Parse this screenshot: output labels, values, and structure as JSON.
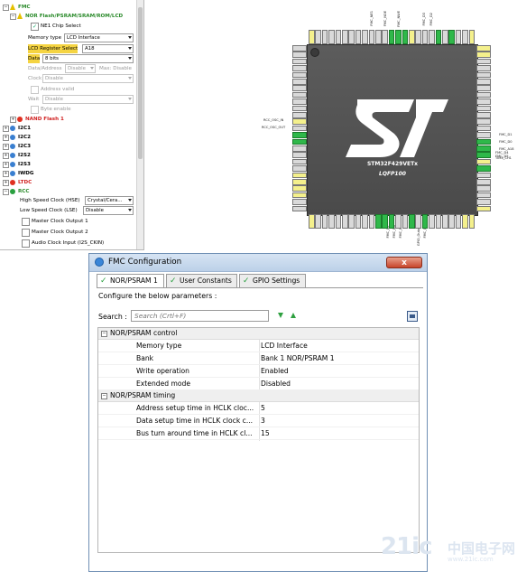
{
  "tree": {
    "fmc": "FMC",
    "nor_flash": "NOR Flash/PSRAM/SRAM/ROM/LCD",
    "ne1_chip_select": "NE1 Chip Select",
    "memory_type_label": "Memory type",
    "memory_type_value": "LCD Interface",
    "lcd_register_select_label": "LCD Register Select",
    "lcd_register_select_value": "A18",
    "data_label": "Data",
    "data_value": "8 bits",
    "data_address_label": "Data/Address",
    "data_address_value": "Disable",
    "max_disable_label": "Max: Disable",
    "clock_label": "Clock",
    "clock_value": "Disable",
    "address_valid": "Address valid",
    "wait_label": "Wait",
    "wait_value": "Disable",
    "byte_enable": "Byte enable",
    "nand_flash": "NAND Flash 1",
    "i2c1": "I2C1",
    "i2c2": "I2C2",
    "i2c3": "I2C3",
    "i2s2": "I2S2",
    "i2s3": "I2S3",
    "iwdg": "IWDG",
    "ltdc": "LTDC",
    "rcc": "RCC",
    "hse_label": "High Speed Clock (HSE)",
    "hse_value": "Crystal/Cera...",
    "lse_label": "Low Speed Clock (LSE)",
    "lse_value": "Disable",
    "mco1": "Master Clock Output 1",
    "mco2": "Master Clock Output 2",
    "audio_clock": "Audio Clock Input (I2S_CKIN)"
  },
  "chip": {
    "part_number": "STM32F429VETx",
    "package": "LQFP100",
    "rcc_osc_in": "RCC_OSC_IN",
    "rcc_osc_out": "RCC_OSC_OUT",
    "right_labels": [
      "FMC_D1",
      "FMC_D0",
      "FMC_A18",
      "FMC_D4",
      "FMC_D5",
      "TIM4_CH1"
    ],
    "top_labels": [
      "FMC_NE1",
      "FMC_NOE",
      "FMC_NWE",
      "FMC_D3",
      "FMC_D2"
    ],
    "bottom_labels": [
      "FMC_D7",
      "FMC_D6",
      "FMC_D5",
      "GPIO_Output",
      "FMC_D4"
    ],
    "logo": "ST"
  },
  "dialog": {
    "title": "FMC Configuration",
    "close_label": "x",
    "tabs": [
      {
        "label": "NOR/PSRAM 1"
      },
      {
        "label": "User Constants"
      },
      {
        "label": "GPIO Settings"
      }
    ],
    "configure_text": "Configure the below parameters :",
    "search_label": "Search :",
    "search_placeholder": "Search (Crtl+F)",
    "groups": [
      {
        "title": "NOR/PSRAM control",
        "rows": [
          {
            "key": "Memory type",
            "value": "LCD Interface"
          },
          {
            "key": "Bank",
            "value": "Bank 1 NOR/PSRAM 1"
          },
          {
            "key": "Write operation",
            "value": "Enabled"
          },
          {
            "key": "Extended mode",
            "value": "Disabled"
          }
        ]
      },
      {
        "title": "NOR/PSRAM timing",
        "rows": [
          {
            "key": "Address setup time in HCLK cloc...",
            "value": "5"
          },
          {
            "key": "Data setup time in HCLK clock c...",
            "value": "3"
          },
          {
            "key": "Bus turn around time in HCLK cl...",
            "value": "15"
          }
        ]
      }
    ]
  },
  "watermark": {
    "big": "21ic",
    "cn": "中国电子网",
    "url": "www.21ic.com"
  },
  "colors": {
    "pin_green": "#2fb84a",
    "pin_yellow": "#f4f08c",
    "chip_body": "#555555",
    "title_bar": "#c8d9ee",
    "close_red": "#c7452b"
  }
}
